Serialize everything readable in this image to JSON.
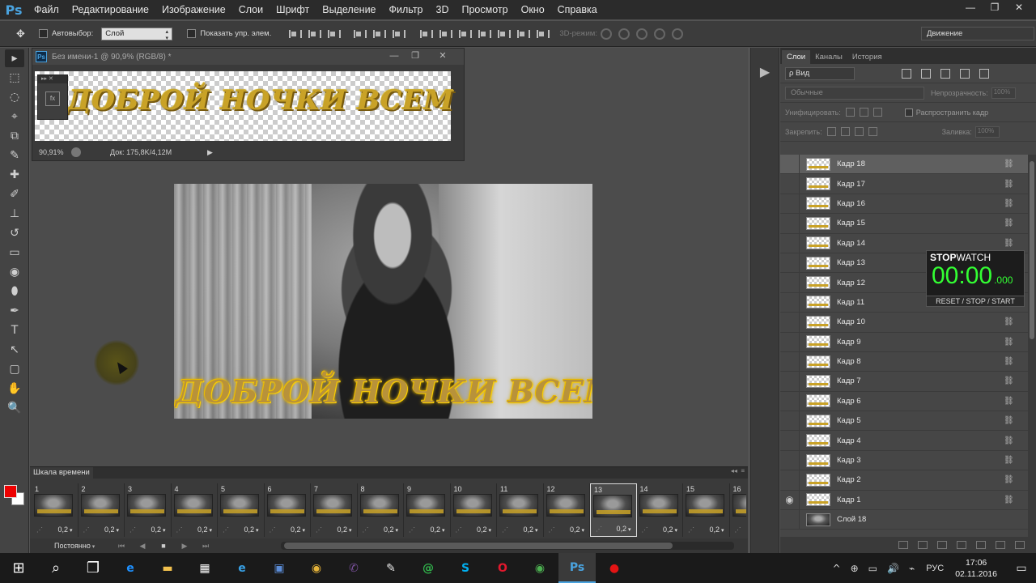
{
  "app": {
    "logo": "Ps",
    "menu": [
      "Файл",
      "Редактирование",
      "Изображение",
      "Слои",
      "Шрифт",
      "Выделение",
      "Фильтр",
      "3D",
      "Просмотр",
      "Окно",
      "Справка"
    ],
    "window_controls": [
      "—",
      "❐",
      "✕"
    ]
  },
  "options": {
    "tool_glyph": "✥",
    "autoselect_label": "Автовыбор:",
    "autoselect_value": "Слой",
    "show_transform_label": "Показать упр. элем.",
    "mode3d_label": "3D-режим:",
    "workspace": "Движение"
  },
  "tools": [
    "▸",
    "⬚",
    "◌",
    "⌖",
    "⧉",
    "✎",
    "✚",
    "✐",
    "⊥",
    "↺",
    "▭",
    "◉",
    "⬮",
    "✒",
    "T",
    "↖",
    "▢",
    "✋",
    "🔍"
  ],
  "document": {
    "title": "Без имени-1 @ 90,9% (RGB/8) *",
    "text": "ДОБРОЙ НОЧКИ ВСЕМ",
    "zoom": "90,91%",
    "doc_size": "Док: 175,8K/4,12M",
    "mini_panel_fx": "fx"
  },
  "image": {
    "caption": "ДОБРОЙ НОЧКИ ВСЕМ"
  },
  "timeline": {
    "tab": "Шкала времени",
    "frames": [
      {
        "n": "1",
        "delay": "0,2"
      },
      {
        "n": "2",
        "delay": "0,2"
      },
      {
        "n": "3",
        "delay": "0,2"
      },
      {
        "n": "4",
        "delay": "0,2"
      },
      {
        "n": "5",
        "delay": "0,2"
      },
      {
        "n": "6",
        "delay": "0,2"
      },
      {
        "n": "7",
        "delay": "0,2"
      },
      {
        "n": "8",
        "delay": "0,2"
      },
      {
        "n": "9",
        "delay": "0,2"
      },
      {
        "n": "10",
        "delay": "0,2"
      },
      {
        "n": "11",
        "delay": "0,2"
      },
      {
        "n": "12",
        "delay": "0,2"
      },
      {
        "n": "13",
        "delay": "0,2"
      },
      {
        "n": "14",
        "delay": "0,2"
      },
      {
        "n": "15",
        "delay": "0,2"
      },
      {
        "n": "16",
        "delay": ""
      }
    ],
    "selected_frame": "13",
    "loop": "Постоянно",
    "controls": [
      "⏮",
      "◀",
      "■",
      "▶",
      "⏭"
    ]
  },
  "layers_panel": {
    "tabs": [
      "Слои",
      "Каналы",
      "История"
    ],
    "kind_filter": "ρ Вид",
    "blend_mode": "Обычные",
    "opacity_label": "Непрозрачность:",
    "opacity_value": "100%",
    "unify_label": "Унифицировать:",
    "propagate_label": "Распространить кадр",
    "lock_label": "Закрепить:",
    "fill_label": "Заливка:",
    "fill_value": "100%",
    "layers": [
      {
        "name": "Кадр 18",
        "visible": false,
        "selected": true
      },
      {
        "name": "Кадр 17",
        "visible": false
      },
      {
        "name": "Кадр 16",
        "visible": false
      },
      {
        "name": "Кадр 15",
        "visible": false
      },
      {
        "name": "Кадр 14",
        "visible": false
      },
      {
        "name": "Кадр 13",
        "visible": false
      },
      {
        "name": "Кадр 12",
        "visible": false
      },
      {
        "name": "Кадр 11",
        "visible": false
      },
      {
        "name": "Кадр 10",
        "visible": false
      },
      {
        "name": "Кадр 9",
        "visible": false
      },
      {
        "name": "Кадр 8",
        "visible": false
      },
      {
        "name": "Кадр 7",
        "visible": false
      },
      {
        "name": "Кадр 6",
        "visible": false
      },
      {
        "name": "Кадр 5",
        "visible": false
      },
      {
        "name": "Кадр 4",
        "visible": false
      },
      {
        "name": "Кадр 3",
        "visible": false
      },
      {
        "name": "Кадр 2",
        "visible": false
      },
      {
        "name": "Кадр 1",
        "visible": true
      },
      {
        "name": "Слой 18",
        "visible": false,
        "photo": true
      }
    ]
  },
  "stopwatch": {
    "title_bold": "STOP",
    "title_rest": "WATCH",
    "time": "00:00",
    "ms": ".000",
    "footer": "RESET / STOP / START"
  },
  "taskbar": {
    "icons": [
      {
        "name": "start-icon",
        "glyph": "⊞",
        "color": "#ffffff"
      },
      {
        "name": "search-icon",
        "glyph": "⌕",
        "color": "#ffffff"
      },
      {
        "name": "task-view-icon",
        "glyph": "❐",
        "color": "#ffffff"
      },
      {
        "name": "edge-icon",
        "glyph": "e",
        "color": "#1e90ff"
      },
      {
        "name": "explorer-icon",
        "glyph": "▬",
        "color": "#f2c14e"
      },
      {
        "name": "store-icon",
        "glyph": "▦",
        "color": "#ffffff"
      },
      {
        "name": "ie-icon",
        "glyph": "e",
        "color": "#38a1e6"
      },
      {
        "name": "network-app-icon",
        "glyph": "▣",
        "color": "#5b8cd6"
      },
      {
        "name": "chrome-icon",
        "glyph": "◉",
        "color": "#e5b33a"
      },
      {
        "name": "viber-icon",
        "glyph": "✆",
        "color": "#7b519d"
      },
      {
        "name": "notepad-icon",
        "glyph": "✎",
        "color": "#e8e8e8"
      },
      {
        "name": "mailru-icon",
        "glyph": "@",
        "color": "#31b24b"
      },
      {
        "name": "skype-icon",
        "glyph": "S",
        "color": "#00aff0"
      },
      {
        "name": "opera-icon",
        "glyph": "O",
        "color": "#e3182d"
      },
      {
        "name": "chrome-canary-icon",
        "glyph": "◉",
        "color": "#4caf50"
      },
      {
        "name": "photoshop-taskbar-icon",
        "glyph": "Ps",
        "color": "#4aa3df"
      },
      {
        "name": "record-icon",
        "glyph": "●",
        "color": "#e31414"
      }
    ],
    "active_index": 15,
    "lang": "РУС",
    "time": "17:06",
    "date": "02.11.2016",
    "tray": [
      "^",
      "⊕",
      "▭",
      "🔊",
      "⌁"
    ]
  }
}
